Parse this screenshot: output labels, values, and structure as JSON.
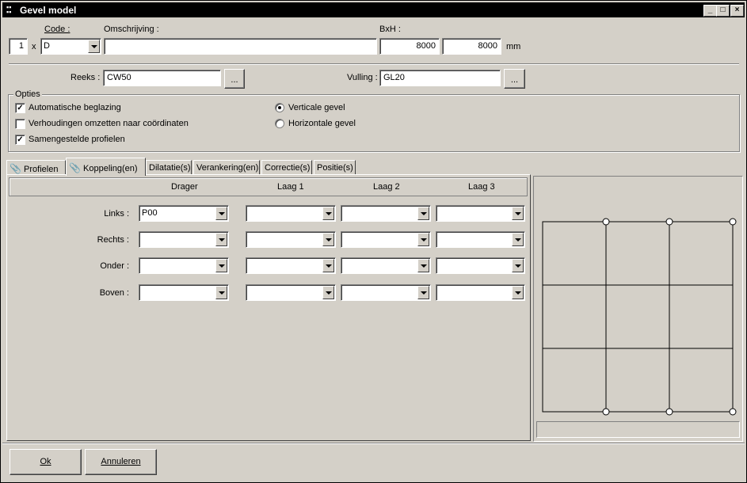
{
  "window": {
    "title": "Gevel model"
  },
  "header": {
    "count_value": "1",
    "times_label": "x",
    "code_label": "Code :",
    "code_value": "D",
    "omschrijving_label": "Omschrijving :",
    "omschrijving_value": "",
    "bxh_label": "BxH :",
    "width_value": "8000",
    "height_value": "8000",
    "unit_label": "mm"
  },
  "reeks": {
    "label": "Reeks :",
    "value": "CW50",
    "browse_label": "..."
  },
  "vulling": {
    "label": "Vulling :",
    "value": "GL20",
    "browse_label": "..."
  },
  "opties": {
    "title": "Opties",
    "checkboxes": [
      {
        "label": "Automatische beglazing",
        "checked": true
      },
      {
        "label": "Verhoudingen omzetten naar coördinaten",
        "checked": false
      },
      {
        "label": "Samengestelde profielen",
        "checked": true
      }
    ],
    "radios": [
      {
        "label": "Verticale gevel",
        "selected": true
      },
      {
        "label": "Horizontale gevel",
        "selected": false
      }
    ]
  },
  "tabs": [
    {
      "label": "Profielen",
      "icon": "paperclip-icon",
      "active": false
    },
    {
      "label": "Koppeling(en)",
      "icon": "paperclip-icon",
      "active": true
    },
    {
      "label": "Dilatatie(s)",
      "active": false
    },
    {
      "label": "Verankering(en)",
      "active": false
    },
    {
      "label": "Correctie(s)",
      "active": false
    },
    {
      "label": "Positie(s)",
      "active": false
    }
  ],
  "grid": {
    "columns": [
      "Drager",
      "Laag 1",
      "Laag 2",
      "Laag 3"
    ],
    "rows": [
      {
        "label": "Links :",
        "values": [
          "P00",
          "",
          "",
          ""
        ]
      },
      {
        "label": "Rechts :",
        "values": [
          "",
          "",
          "",
          ""
        ]
      },
      {
        "label": "Onder :",
        "values": [
          "",
          "",
          "",
          ""
        ]
      },
      {
        "label": "Boven :",
        "values": [
          "",
          "",
          "",
          ""
        ]
      }
    ]
  },
  "preview": {
    "status_text": ""
  },
  "footer": {
    "ok_label": "Ok",
    "cancel_label": "Annuleren"
  },
  "colors": {
    "face": "#d4d0c8",
    "title_bar": "#000000",
    "field": "#ffffff"
  }
}
